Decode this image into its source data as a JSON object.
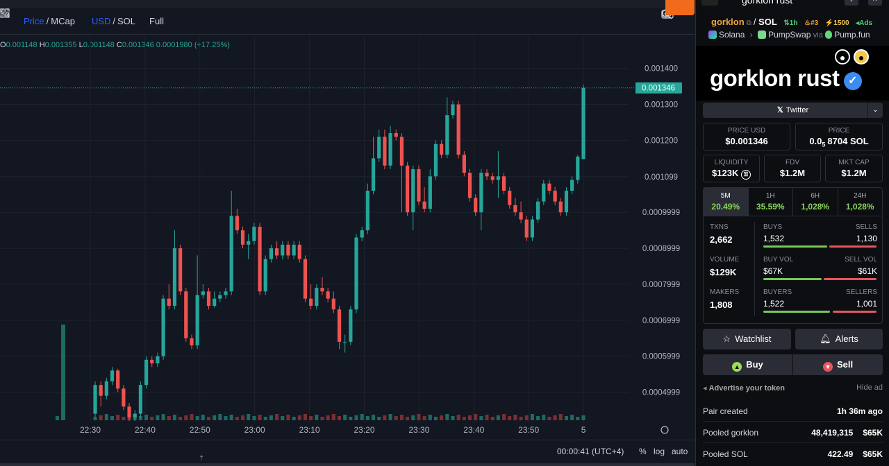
{
  "toolbar": {
    "price_label": "Price",
    "mcap_label": "MCap",
    "usd_label": "USD",
    "sol_label": "SOL",
    "full_label": "Full"
  },
  "ohlc": {
    "o_key": "O",
    "o": "0.001148",
    "h_key": "H",
    "h": "0.001355",
    "l_key": "L",
    "l": "0.001148",
    "c_key": "C",
    "c": "0.001346",
    "change": "0.0001980 (+17.25%)"
  },
  "bottombar": {
    "clock": "00:00:41 (UTC+4)",
    "percent": "%",
    "log": "log",
    "auto": "auto"
  },
  "chart_data": {
    "type": "candlestick",
    "x_ticks": [
      "22:30",
      "22:40",
      "22:50",
      "23:00",
      "23:10",
      "23:20",
      "23:30",
      "23:40",
      "23:50",
      "5"
    ],
    "y_ticks": [
      "0.001400",
      "0.001300",
      "0.001200",
      "0.001099",
      "0.0009999",
      "0.0008999",
      "0.0007999",
      "0.0006999",
      "0.0005999",
      "0.0004999"
    ],
    "ylim": [
      0.00042,
      0.00149
    ],
    "last_price_label": "0.001346",
    "colors": {
      "up": "#26a69a",
      "down": "#ef5350"
    },
    "candles": [
      [
        0.00044,
        0.00052,
        0.00043,
        0.00053
      ],
      [
        0.00052,
        0.00049,
        0.00046,
        0.00053
      ],
      [
        0.00049,
        0.00053,
        0.00048,
        0.00054
      ],
      [
        0.00053,
        0.00056,
        0.00052,
        0.00057
      ],
      [
        0.00056,
        0.00051,
        0.0005,
        0.000565
      ],
      [
        0.00051,
        0.00046,
        0.00045,
        0.00052
      ],
      [
        0.00046,
        0.00043,
        0.00042,
        0.00047
      ],
      [
        0.00043,
        0.00044,
        0.00042,
        0.00045
      ],
      [
        0.00044,
        0.00052,
        0.00043,
        0.00053
      ],
      [
        0.00052,
        0.00059,
        0.00051,
        0.0006
      ],
      [
        0.00059,
        0.00058,
        0.00057,
        0.0006
      ],
      [
        0.00058,
        0.0006,
        0.00057,
        0.00061
      ],
      [
        0.0006,
        0.00076,
        0.00059,
        0.00077
      ],
      [
        0.00076,
        0.00074,
        0.00073,
        0.0008
      ],
      [
        0.00074,
        0.0009,
        0.00073,
        0.00095
      ],
      [
        0.0009,
        0.00078,
        0.00077,
        0.00091
      ],
      [
        0.00078,
        0.00065,
        0.00064,
        0.00079
      ],
      [
        0.00065,
        0.00063,
        0.00062,
        0.00066
      ],
      [
        0.00063,
        0.00077,
        0.00062,
        0.00088
      ],
      [
        0.00077,
        0.00078,
        0.00076,
        0.0008
      ],
      [
        0.00078,
        0.00074,
        0.00073,
        0.00079
      ],
      [
        0.00074,
        0.00076,
        0.000735,
        0.00078
      ],
      [
        0.00076,
        0.00077,
        0.00075,
        0.00078
      ],
      [
        0.00077,
        0.00078,
        0.00076,
        0.00079
      ],
      [
        0.00078,
        0.00099,
        0.00077,
        0.00106
      ],
      [
        0.00099,
        0.00095,
        0.00094,
        0.00101
      ],
      [
        0.00095,
        0.00091,
        0.0009,
        0.00096
      ],
      [
        0.00091,
        0.00092,
        0.00087,
        0.00094
      ],
      [
        0.00092,
        0.00096,
        0.00091,
        0.00097
      ],
      [
        0.00096,
        0.00078,
        0.00077,
        0.00097
      ],
      [
        0.00078,
        0.00087,
        0.00077,
        0.00088
      ],
      [
        0.00087,
        0.0009,
        0.00086,
        0.00091
      ],
      [
        0.0009,
        0.00088,
        0.00087,
        0.00092
      ],
      [
        0.00088,
        0.00091,
        0.00087,
        0.00092
      ],
      [
        0.00091,
        0.00088,
        0.00087,
        0.00092
      ],
      [
        0.00088,
        0.00091,
        0.00087,
        0.00092
      ],
      [
        0.00091,
        0.00087,
        0.00086,
        0.00092
      ],
      [
        0.00087,
        0.00076,
        0.00075,
        0.00088
      ],
      [
        0.00076,
        0.00074,
        0.00073,
        0.0008
      ],
      [
        0.00074,
        0.00079,
        0.00073,
        0.0008
      ],
      [
        0.00079,
        0.00078,
        0.00077,
        0.00082
      ],
      [
        0.00078,
        0.00076,
        0.00075,
        0.00079
      ],
      [
        0.00076,
        0.00073,
        0.00072,
        0.00078
      ],
      [
        0.00073,
        0.00064,
        0.00062,
        0.00074
      ],
      [
        0.00064,
        0.00064,
        0.00061,
        0.00066
      ],
      [
        0.00064,
        0.00073,
        0.00063,
        0.00074
      ],
      [
        0.00073,
        0.00093,
        0.00072,
        0.00094
      ],
      [
        0.00093,
        0.00095,
        0.00092,
        0.00096
      ],
      [
        0.00095,
        0.00106,
        0.00094,
        0.00108
      ],
      [
        0.00106,
        0.00115,
        0.00105,
        0.00121
      ],
      [
        0.00115,
        0.00121,
        0.00114,
        0.00123
      ],
      [
        0.00121,
        0.00113,
        0.00112,
        0.00123
      ],
      [
        0.00113,
        0.00122,
        0.00112,
        0.00124
      ],
      [
        0.00122,
        0.00121,
        0.0012,
        0.00123
      ],
      [
        0.00121,
        0.00113,
        0.001,
        0.00122
      ],
      [
        0.00113,
        0.001,
        0.00099,
        0.00114
      ],
      [
        0.001,
        0.00112,
        0.00095,
        0.00113
      ],
      [
        0.00112,
        0.00103,
        0.00102,
        0.00113
      ],
      [
        0.00103,
        0.00101,
        0.001,
        0.00107
      ],
      [
        0.00101,
        0.0011,
        0.001,
        0.00112
      ],
      [
        0.0011,
        0.00119,
        0.00109,
        0.0012
      ],
      [
        0.00119,
        0.00116,
        0.00115,
        0.0012
      ],
      [
        0.00116,
        0.00127,
        0.00115,
        0.00132
      ],
      [
        0.00127,
        0.0013,
        0.00126,
        0.00131
      ],
      [
        0.0013,
        0.00116,
        0.00115,
        0.00131
      ],
      [
        0.00116,
        0.00111,
        0.0011,
        0.00117
      ],
      [
        0.00111,
        0.00104,
        0.00103,
        0.00112
      ],
      [
        0.00104,
        0.001,
        0.00099,
        0.00105
      ],
      [
        0.001,
        0.00111,
        0.00095,
        0.00112
      ],
      [
        0.00111,
        0.0011,
        0.00109,
        0.00112
      ],
      [
        0.0011,
        0.00109,
        0.00108,
        0.00111
      ],
      [
        0.00109,
        0.0011,
        0.00104,
        0.00117
      ],
      [
        0.0011,
        0.00106,
        0.00105,
        0.00111
      ],
      [
        0.00106,
        0.00102,
        0.00101,
        0.00107
      ],
      [
        0.00102,
        0.001,
        0.00099,
        0.00104
      ],
      [
        0.001,
        0.00098,
        0.00097,
        0.00103
      ],
      [
        0.00098,
        0.00093,
        0.00092,
        0.00099
      ],
      [
        0.00093,
        0.00098,
        0.00092,
        0.00099
      ],
      [
        0.00098,
        0.00103,
        0.00097,
        0.00104
      ],
      [
        0.00103,
        0.00108,
        0.00102,
        0.00109
      ],
      [
        0.00108,
        0.00106,
        0.00105,
        0.00109
      ],
      [
        0.00106,
        0.00103,
        0.00102,
        0.00107
      ],
      [
        0.00103,
        0.001,
        0.00099,
        0.00104
      ],
      [
        0.001,
        0.00106,
        0.00099,
        0.00107
      ],
      [
        0.00106,
        0.00109,
        0.00105,
        0.0011
      ],
      [
        0.00109,
        0.001155,
        0.00108,
        0.00116
      ],
      [
        0.001148,
        0.001346,
        0.001148,
        0.001355
      ]
    ]
  },
  "panel": {
    "base": "gorklon",
    "quote": "SOL",
    "header_name": "gorklon rust",
    "tag_timeframe": "1h",
    "tag_rank": "#3",
    "tag_boost": "1500",
    "tag_ads": "Ads",
    "chain": "Solana",
    "dex": "PumpSwap",
    "via": "via",
    "launchpad": "Pump.fun",
    "banner_text": "gorklon rust",
    "twitter": "Twitter",
    "price_usd_label": "PRICE USD",
    "price_usd": "$0.001346",
    "price_label": "PRICE",
    "price_sol_prefix": "0.0",
    "price_sol_sub": "5",
    "price_sol_rest": "8704 SOL",
    "liquidity_label": "LIQUIDITY",
    "liquidity": "$123K",
    "fdv_label": "FDV",
    "fdv": "$1.2M",
    "mcap_label": "MKT CAP",
    "mcap": "$1.2M",
    "tabs": [
      {
        "label": "5M",
        "value": "20.49%"
      },
      {
        "label": "1H",
        "value": "35.59%"
      },
      {
        "label": "6H",
        "value": "1,028%"
      },
      {
        "label": "24H",
        "value": "1,028%"
      }
    ],
    "txns_label": "TXNS",
    "txns": "2,662",
    "buys_label": "BUYS",
    "buys": "1,532",
    "sells_label": "SELLS",
    "sells": "1,130",
    "volume_label": "VOLUME",
    "volume": "$129K",
    "buyvol_label": "BUY VOL",
    "buyvol": "$67K",
    "sellvol_label": "SELL VOL",
    "sellvol": "$61K",
    "makers_label": "MAKERS",
    "makers": "1,808",
    "buyers_label": "BUYERS",
    "buyers": "1,522",
    "sellers_label": "SELLERS",
    "sellers": "1,001",
    "watchlist": "Watchlist",
    "alerts": "Alerts",
    "buy": "Buy",
    "sell": "Sell",
    "advertise": "Advertise your token",
    "hide_ad": "Hide ad",
    "pair_created_label": "Pair created",
    "pair_created": "1h 36m ago",
    "pooled_base_label": "Pooled gorklon",
    "pooled_base": "48,419,315",
    "pooled_base_usd": "$65K",
    "pooled_sol_label": "Pooled SOL",
    "pooled_sol": "422.49",
    "pooled_sol_usd": "$65K"
  }
}
